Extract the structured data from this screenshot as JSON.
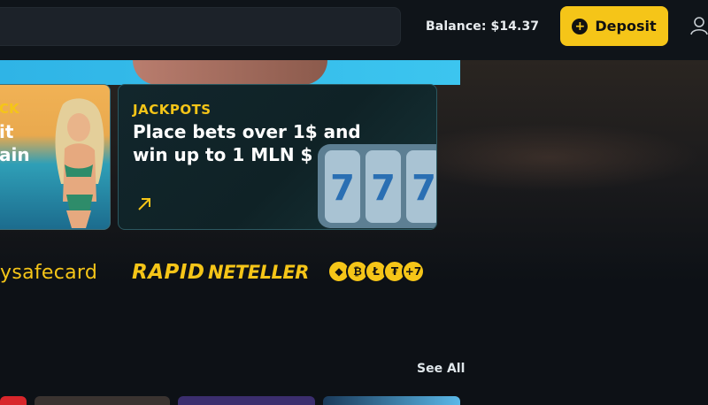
{
  "header": {
    "balance_text": "Balance: $14.37",
    "deposit_label": "Deposit",
    "deposit_icon": "plus-circle-icon",
    "user_icon": "user-icon"
  },
  "promos": [
    {
      "kicker": "CK",
      "title_lines": [
        "it",
        "ain"
      ]
    },
    {
      "kicker": "JACKPOTS",
      "headline": "Place bets over 1$ and win up to 1 MLN $",
      "link_icon": "arrow-up-right-icon"
    }
  ],
  "payments": {
    "paysafecard": "ysafecard",
    "rapid": "RAPID",
    "neteller": "NETELLER",
    "crypto_more": "+7"
  },
  "see_all_label": "See All",
  "colors": {
    "accent": "#f5c518",
    "background": "#0d1116",
    "card_border": "#2c5860"
  }
}
